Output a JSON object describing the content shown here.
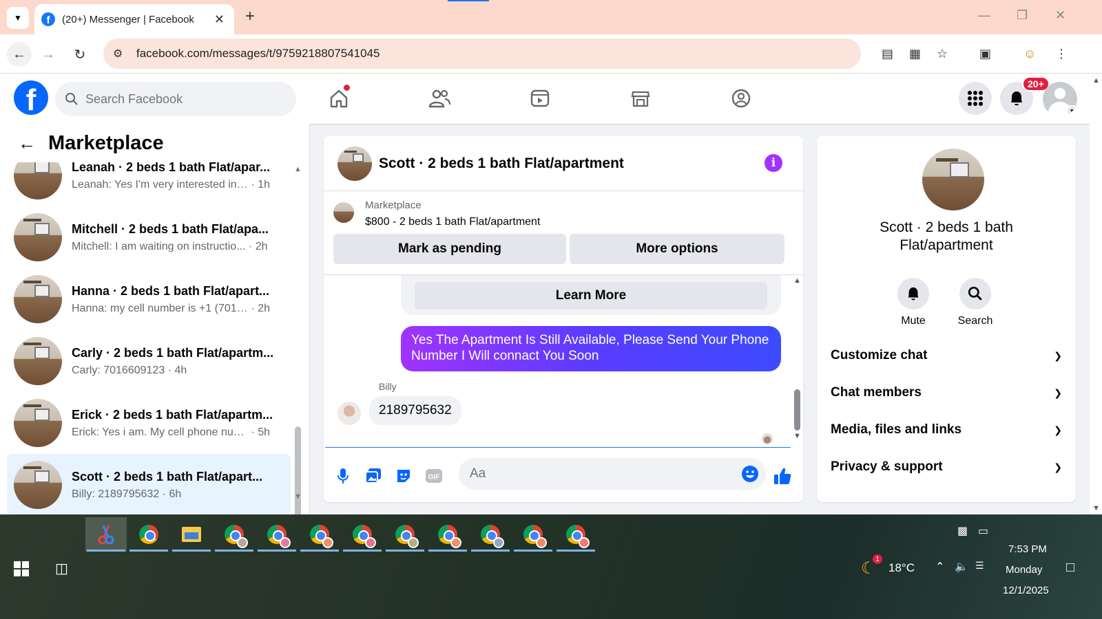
{
  "browser": {
    "tab_title": "(20+) Messenger | Facebook",
    "url": "facebook.com/messages/t/9759218807541045"
  },
  "fb_header": {
    "search_placeholder": "Search Facebook",
    "notifications_badge": "20+"
  },
  "sidebar": {
    "title": "Marketplace",
    "conversations": [
      {
        "name": "Leanah · 2 beds 1 bath Flat/apar...",
        "preview": "Leanah: Yes I'm very interested in t...",
        "time": "1h",
        "active": false
      },
      {
        "name": "Mitchell · 2 beds 1 bath Flat/apa...",
        "preview": "Mitchell: I am waiting on instructio...",
        "time": "2h",
        "active": false
      },
      {
        "name": "Hanna · 2 beds 1 bath Flat/apart...",
        "preview": "Hanna: my cell number is +1 (701) ...",
        "time": "2h",
        "active": false
      },
      {
        "name": "Carly · 2 beds 1 bath Flat/apartm...",
        "preview": "Carly: 7016609123",
        "time": "4h",
        "active": false
      },
      {
        "name": "Erick · 2 beds 1 bath Flat/apartm...",
        "preview": "Erick: Yes i am. My cell phone num...",
        "time": "5h",
        "active": false
      },
      {
        "name": "Scott · 2 beds 1 bath Flat/apart...",
        "preview": "Billy: 2189795632",
        "time": "6h",
        "active": true
      }
    ]
  },
  "chat": {
    "title": "Scott · 2 beds 1 bath Flat/apartment",
    "marketplace_label": "Marketplace",
    "listing": "$800 - 2 beds 1 bath Flat/apartment",
    "mark_pending": "Mark as pending",
    "more_options": "More options",
    "learn_more": "Learn More",
    "outgoing_message": "Yes The Apartment Is Still Available, Please Send Your Phone Number I Will connact You Soon",
    "sender_name": "Billy",
    "incoming_message": "2189795632",
    "composer_placeholder": "Aa"
  },
  "right_panel": {
    "name": "Scott · 2 beds 1 bath Flat/apartment",
    "mute": "Mute",
    "search": "Search",
    "sections": [
      "Customize chat",
      "Chat members",
      "Media, files and links",
      "Privacy & support"
    ]
  },
  "taskbar": {
    "weather": "18°C",
    "weather_badge": "1",
    "time": "7:53 PM",
    "day": "Monday",
    "date": "12/1/2025"
  }
}
